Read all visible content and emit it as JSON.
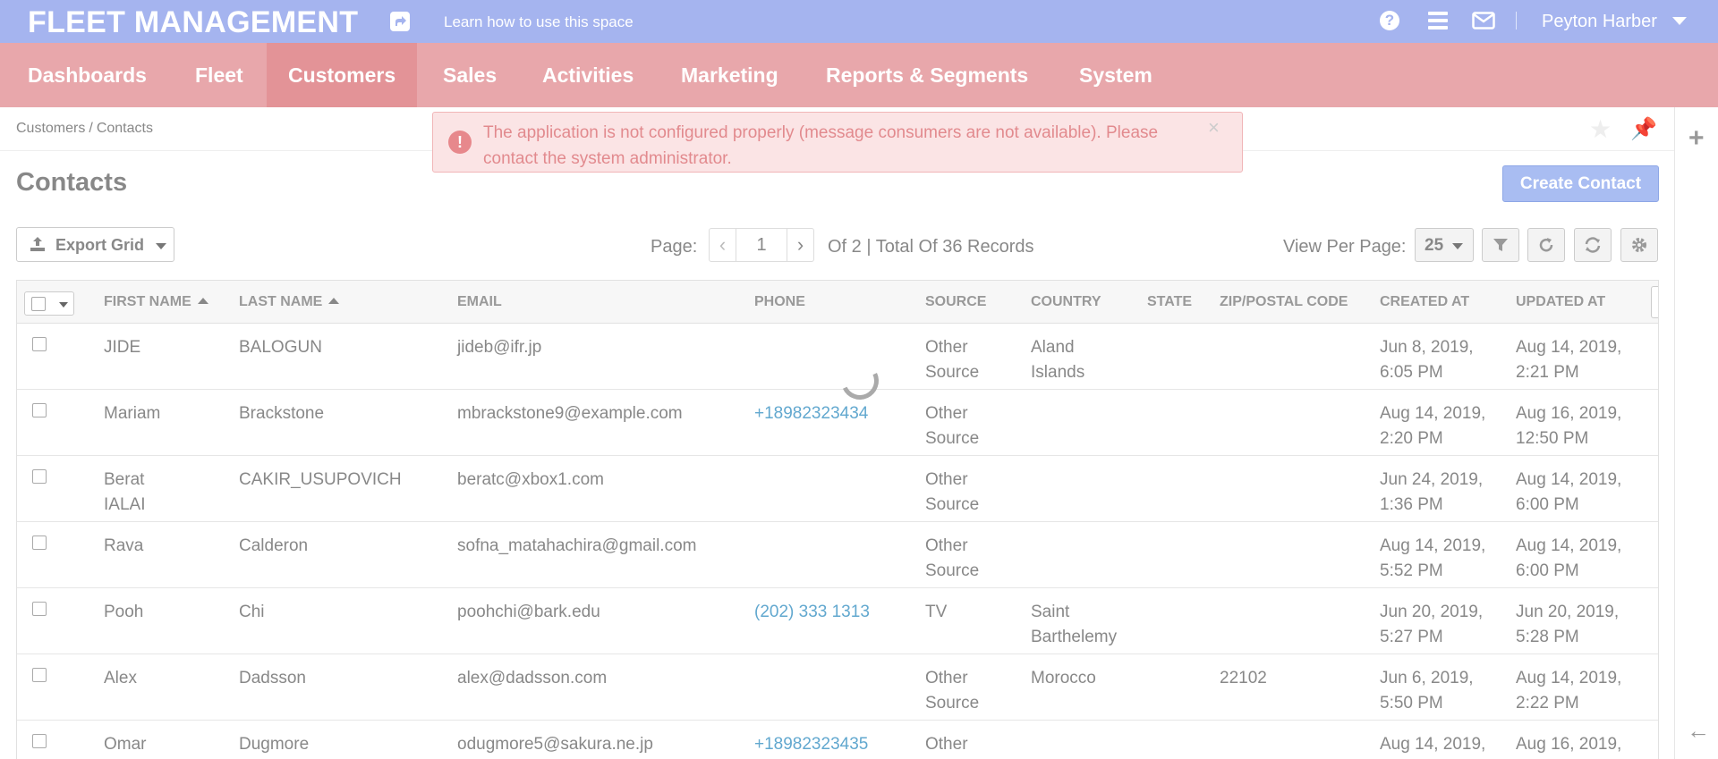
{
  "header": {
    "brand": "FLEET MANAGEMENT",
    "learn_link": "Learn how to use this space",
    "user_name": "Peyton Harber",
    "help_glyph": "?"
  },
  "nav": {
    "items": [
      {
        "label": "Dashboards"
      },
      {
        "label": "Fleet"
      },
      {
        "label": "Customers",
        "active": true
      },
      {
        "label": "Sales"
      },
      {
        "label": "Activities"
      },
      {
        "label": "Marketing"
      },
      {
        "label": "Reports & Segments"
      },
      {
        "label": "System"
      }
    ]
  },
  "breadcrumb": {
    "parent": "Customers",
    "separator": "/",
    "current": "Contacts"
  },
  "alert": {
    "message": "The application is not configured properly (message consumers are not available). Please contact the system administrator.",
    "icon_glyph": "!",
    "close_glyph": "×"
  },
  "page": {
    "title": "Contacts",
    "create_button": "Create Contact"
  },
  "toolbar": {
    "export_label": "Export Grid",
    "page_label": "Page:",
    "current_page": "1",
    "records_text": "Of 2 | Total Of 36 Records",
    "view_per_page_label": "View Per Page:",
    "view_per_page_value": "25"
  },
  "grid": {
    "columns": {
      "first_name": "FIRST NAME",
      "last_name": "LAST NAME",
      "email": "EMAIL",
      "phone": "PHONE",
      "source": "SOURCE",
      "country": "COUNTRY",
      "state": "STATE",
      "zip": "ZIP/POSTAL CODE",
      "created_at": "CREATED AT",
      "updated_at": "UPDATED AT"
    },
    "rows": [
      {
        "first": "JIDE",
        "last": "BALOGUN",
        "email": "jideb@ifr.jp",
        "phone": "",
        "source": "Other\nSource",
        "country": "Aland\nIslands",
        "state": "",
        "zip": "",
        "created": "Jun 8, 2019,\n6:05 PM",
        "updated": "Aug 14, 2019,\n2:21 PM"
      },
      {
        "first": "Mariam",
        "last": "Brackstone",
        "email": "mbrackstone9@example.com",
        "phone": "+18982323434",
        "source": "Other\nSource",
        "country": "",
        "state": "",
        "zip": "",
        "created": "Aug 14, 2019,\n2:20 PM",
        "updated": "Aug 16, 2019,\n12:50 PM"
      },
      {
        "first": "Berat\nIALAI",
        "last": "CAKIR_USUPOVICH",
        "email": "beratc@xbox1.com",
        "phone": "",
        "source": "Other\nSource",
        "country": "",
        "state": "",
        "zip": "",
        "created": "Jun 24, 2019,\n1:36 PM",
        "updated": "Aug 14, 2019,\n6:00 PM"
      },
      {
        "first": "Rava",
        "last": "Calderon",
        "email": "sofna_matahachira@gmail.com",
        "phone": "",
        "source": "Other\nSource",
        "country": "",
        "state": "",
        "zip": "",
        "created": "Aug 14, 2019,\n5:52 PM",
        "updated": "Aug 14, 2019,\n6:00 PM"
      },
      {
        "first": "Pooh",
        "last": "Chi",
        "email": "poohchi@bark.edu",
        "phone": "(202) 333 1313",
        "source": "TV",
        "country": "Saint\nBarthelemy",
        "state": "",
        "zip": "",
        "created": "Jun 20, 2019,\n5:27 PM",
        "updated": "Jun 20, 2019,\n5:28 PM"
      },
      {
        "first": "Alex",
        "last": "Dadsson",
        "email": "alex@dadsson.com",
        "phone": "",
        "source": "Other\nSource",
        "country": "Morocco",
        "state": "",
        "zip": "22102",
        "created": "Jun 6, 2019,\n5:50 PM",
        "updated": "Aug 14, 2019,\n2:22 PM"
      },
      {
        "first": "Omar",
        "last": "Dugmore",
        "email": "odugmore5@sakura.ne.jp",
        "phone": "+18982323435",
        "source": "Other",
        "country": "",
        "state": "",
        "zip": "",
        "created": "Aug 14, 2019,",
        "updated": "Aug 16, 2019,"
      }
    ]
  },
  "colors": {
    "topbar": "#a5b4ef",
    "nav": "#e8a7ab",
    "nav_active": "#e39397",
    "alert_bg": "#fbe4e5",
    "primary_button": "#a9bdf2",
    "link": "#62a8cf"
  },
  "icons": [
    "share-icon",
    "help-icon",
    "menu-icon",
    "mail-icon",
    "caret-down-icon",
    "star-icon",
    "pin-icon",
    "plus-icon",
    "arrow-left-icon",
    "upload-icon",
    "filter-icon",
    "refresh-icon",
    "sync-icon",
    "gear-icon",
    "loading-spinner-icon",
    "alert-icon",
    "close-icon"
  ]
}
